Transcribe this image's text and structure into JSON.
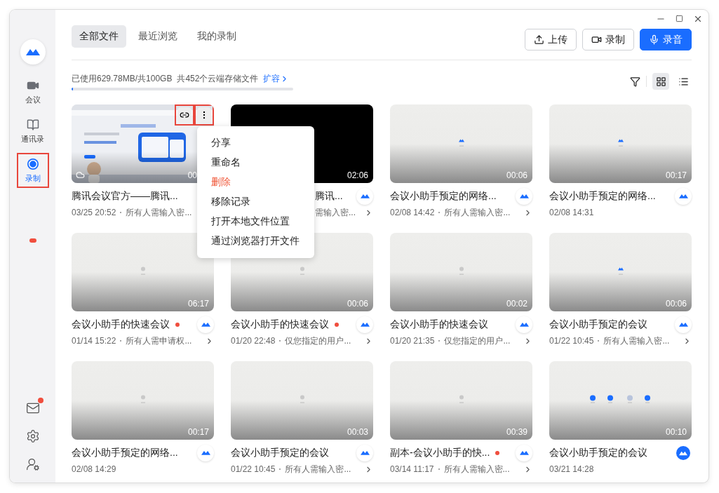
{
  "sidebar": {
    "items": [
      {
        "kind": "video",
        "label": "会议",
        "selected": false,
        "highlighted": false
      },
      {
        "kind": "book",
        "label": "通讯录",
        "selected": false,
        "highlighted": false
      },
      {
        "kind": "record",
        "label": "录制",
        "selected": true,
        "highlighted": true
      }
    ],
    "bottom": [
      {
        "kind": "mail",
        "dot": true
      },
      {
        "kind": "gear",
        "dot": false
      },
      {
        "kind": "switch-user",
        "dot": false
      }
    ]
  },
  "tabs": [
    {
      "label": "全部文件",
      "selected": true
    },
    {
      "label": "最近浏览",
      "selected": false
    },
    {
      "label": "我的录制",
      "selected": false
    }
  ],
  "actions": [
    {
      "kind": "upload",
      "label": "上传",
      "primary": false
    },
    {
      "kind": "record",
      "label": "录制",
      "primary": false
    },
    {
      "kind": "mic",
      "label": "录音",
      "primary": true
    }
  ],
  "storage": {
    "text": "已使用629.78MB/共100GB",
    "count": "共452个云端存储文件",
    "link": "扩容",
    "level": 0.006
  },
  "view": {
    "grid": true
  },
  "menu": {
    "items": [
      {
        "label": "分享",
        "kind": "normal"
      },
      {
        "label": "重命名",
        "kind": "normal"
      },
      {
        "label": "删除",
        "kind": "danger"
      },
      {
        "label": "移除记录",
        "kind": "normal"
      },
      {
        "label": "打开本地文件位置",
        "kind": "normal"
      },
      {
        "label": "通过浏览器打开文件",
        "kind": "normal"
      }
    ]
  },
  "cards": [
    {
      "kind": "screenshot",
      "duration": "00",
      "title": "腾讯会议官方——腾讯...",
      "date": "03/25 20:52",
      "access": "所有人需输入密...",
      "dot": false,
      "menu_open": true,
      "covered": false
    },
    {
      "kind": "black",
      "duration": "02:06",
      "title": "腾讯...",
      "access": "需输入密...",
      "badge": {
        "kind": "outline"
      },
      "dot": false,
      "menu_open": false,
      "covered": true
    },
    {
      "kind": "logo",
      "duration": "00:06",
      "title": "会议小助手预定的网络...",
      "date": "02/08 14:42",
      "access": "所有人需输入密...",
      "badge": {
        "kind": "outline"
      },
      "dot": false,
      "menu_open": false,
      "covered": false
    },
    {
      "kind": "logo",
      "duration": "00:17",
      "title": "会议小助手预定的网络...",
      "date": "02/08 14:31",
      "badge": {
        "kind": "outline"
      },
      "dot": false,
      "menu_open": false,
      "covered": false
    },
    {
      "kind": "avatar",
      "duration": "06:17",
      "title": "会议小助手的快速会议",
      "date": "01/14 15:22",
      "access": "所有人需申请权...",
      "badge": {
        "kind": "outline"
      },
      "dot": true,
      "menu_open": false,
      "covered": false
    },
    {
      "kind": "avatar",
      "duration": "00:06",
      "title": "会议小助手的快速会议",
      "date": "01/20 22:48",
      "access": "仅您指定的用户...",
      "badge": {
        "kind": "outline"
      },
      "dot": true,
      "menu_open": false,
      "covered": false
    },
    {
      "kind": "avatar",
      "duration": "00:02",
      "title": "会议小助手的快速会议",
      "date": "01/20 21:35",
      "access": "仅您指定的用户...",
      "badge": {
        "kind": "outline"
      },
      "dot": false,
      "menu_open": false,
      "covered": false
    },
    {
      "kind": "logo",
      "duration": "00:06",
      "title": "会议小助手预定的会议",
      "date": "01/22 10:45",
      "access": "所有人需输入密...",
      "badge": {
        "kind": "outline"
      },
      "dot": false,
      "menu_open": false,
      "covered": false
    },
    {
      "kind": "avatar",
      "duration": "00:17",
      "title": "会议小助手预定的网络...",
      "date": "02/08 14:29",
      "badge": {
        "kind": "outline"
      },
      "dot": false,
      "menu_open": false,
      "covered": false
    },
    {
      "kind": "avatar",
      "duration": "00:03",
      "title": "会议小助手预定的会议",
      "date": "01/22 10:45",
      "access": "所有人需输入密...",
      "badge": {
        "kind": "outline"
      },
      "dot": false,
      "menu_open": false,
      "covered": false
    },
    {
      "kind": "avatar",
      "duration": "00:39",
      "title": "副本-会议小助手的快...",
      "date": "03/14 11:17",
      "access": "所有人需输入密...",
      "badge": {
        "kind": "outline"
      },
      "dot": true,
      "menu_open": false,
      "covered": false
    },
    {
      "kind": "multi",
      "duration": "00:10",
      "title": "会议小助手预定的会议",
      "date": "03/21 14:28",
      "badge": {
        "kind": "solid"
      },
      "dot": false,
      "menu_open": false,
      "covered": false
    }
  ]
}
